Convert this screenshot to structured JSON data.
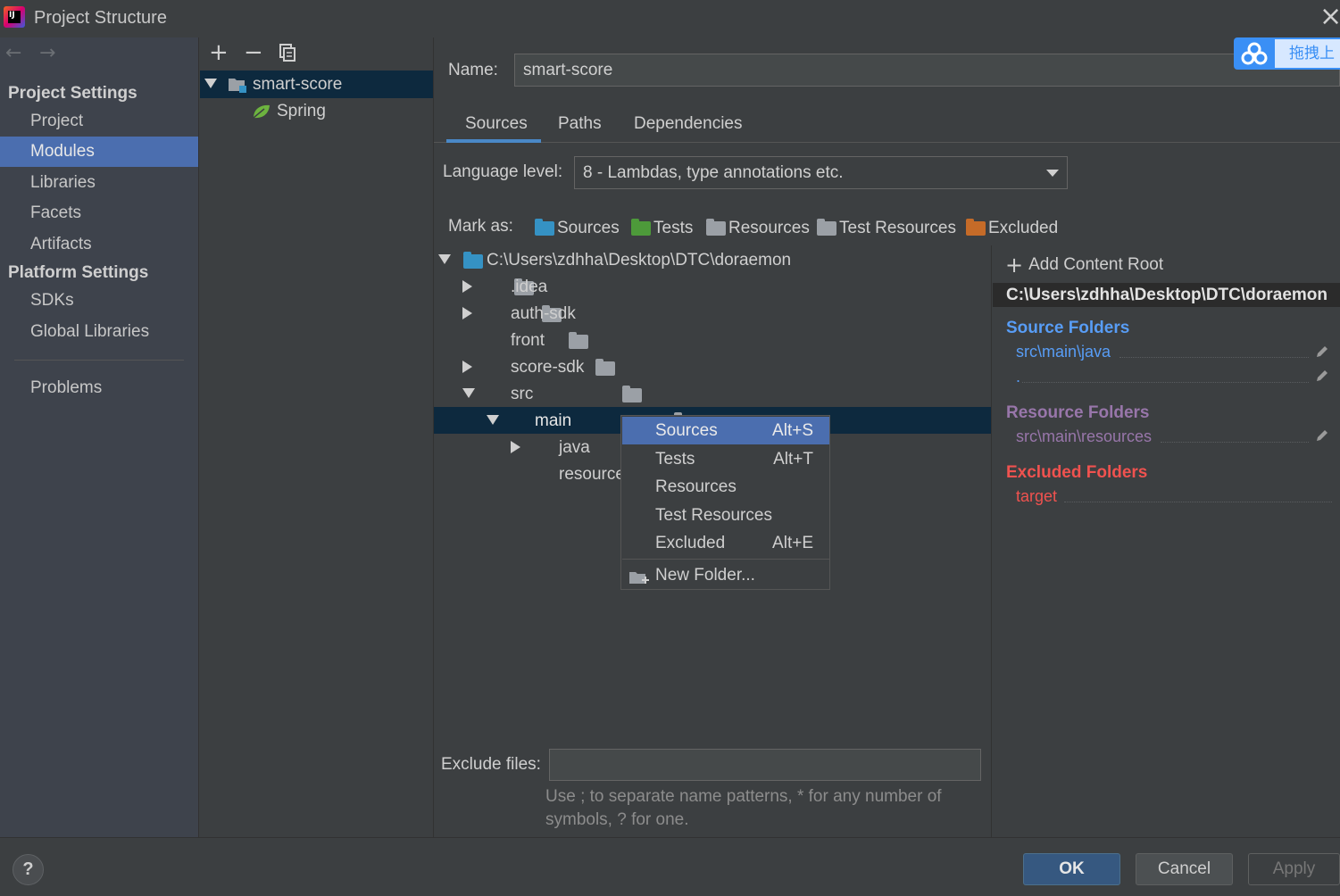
{
  "window": {
    "title": "Project Structure"
  },
  "nav": {
    "project_settings_header": "Project Settings",
    "project_items": [
      "Project",
      "Modules",
      "Libraries",
      "Facets",
      "Artifacts"
    ],
    "platform_settings_header": "Platform Settings",
    "platform_items": [
      "SDKs",
      "Global Libraries"
    ],
    "problems": "Problems",
    "selected": "Modules"
  },
  "modules": {
    "toolbar": {
      "add": "+",
      "remove": "−"
    },
    "items": [
      {
        "label": "smart-score",
        "icon": "module-icon",
        "selected": true
      },
      {
        "label": "Spring",
        "icon": "spring-leaf-icon",
        "selected": false
      }
    ]
  },
  "overlay": {
    "baidu_label": "拖拽上"
  },
  "main": {
    "name_label": "Name:",
    "name_value": "smart-score",
    "tabs": [
      "Sources",
      "Paths",
      "Dependencies"
    ],
    "active_tab": "Sources",
    "language_label": "Language level:",
    "language_value": "8 - Lambdas, type annotations etc.",
    "mark_as_label": "Mark as:",
    "mark_buttons": [
      "Sources",
      "Tests",
      "Resources",
      "Test Resources",
      "Excluded"
    ],
    "tree": {
      "root": "C:\\Users\\zdhha\\Desktop\\DTC\\doraemon",
      "nodes": [
        ".idea",
        "auth-sdk",
        "front",
        "score-sdk",
        "src",
        "main",
        "java",
        "resource"
      ]
    },
    "exclude_label": "Exclude files:",
    "exclude_hint_1": "Use ; to separate name patterns, * for any number of",
    "exclude_hint_2": "symbols, ? for one."
  },
  "context_menu": {
    "items": [
      {
        "label": "Sources",
        "shortcut": "Alt+S"
      },
      {
        "label": "Tests",
        "shortcut": "Alt+T"
      },
      {
        "label": "Resources",
        "shortcut": ""
      },
      {
        "label": "Test Resources",
        "shortcut": ""
      },
      {
        "label": "Excluded",
        "shortcut": "Alt+E"
      }
    ],
    "new_folder": "New Folder..."
  },
  "content_root": {
    "add_label": "Add Content Root",
    "root_path": "C:\\Users\\zdhha\\Desktop\\DTC\\doraemon",
    "source_title": "Source Folders",
    "source_items": [
      "src\\main\\java",
      "."
    ],
    "resource_title": "Resource Folders",
    "resource_items": [
      "src\\main\\resources"
    ],
    "excluded_title": "Excluded Folders",
    "excluded_items": [
      "target"
    ]
  },
  "buttons": {
    "help": "?",
    "ok": "OK",
    "cancel": "Cancel",
    "apply": "Apply"
  },
  "colors": {
    "selection": "#4b6eaf",
    "source_blue": "#3592c4",
    "test_green": "#4d9a3a",
    "resource_purple": "#9876aa",
    "excluded_orange": "#c56b28",
    "source_title": "#589df6",
    "resource_title": "#9876aa",
    "excluded_title": "#f0524f"
  }
}
